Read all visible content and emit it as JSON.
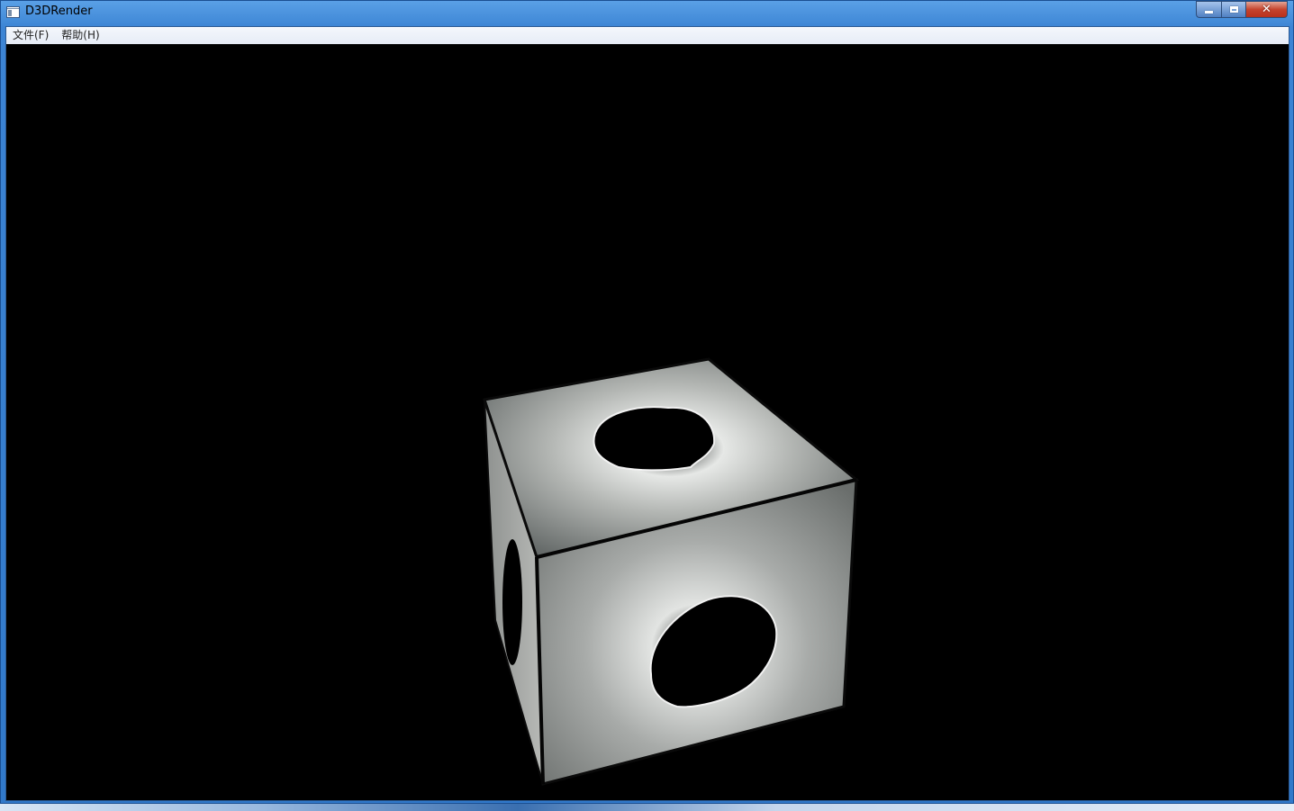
{
  "window": {
    "title": "D3DRender"
  },
  "menu": {
    "items": [
      {
        "label": "文件(F)"
      },
      {
        "label": "帮助(H)"
      }
    ]
  },
  "caption_buttons": {
    "close_glyph": "✕"
  },
  "scene": {
    "object": "textured-cube",
    "background_color": "#000000",
    "texture_colors": [
      "#d9dcd9",
      "#8d918f",
      "#4a4f4e"
    ]
  }
}
